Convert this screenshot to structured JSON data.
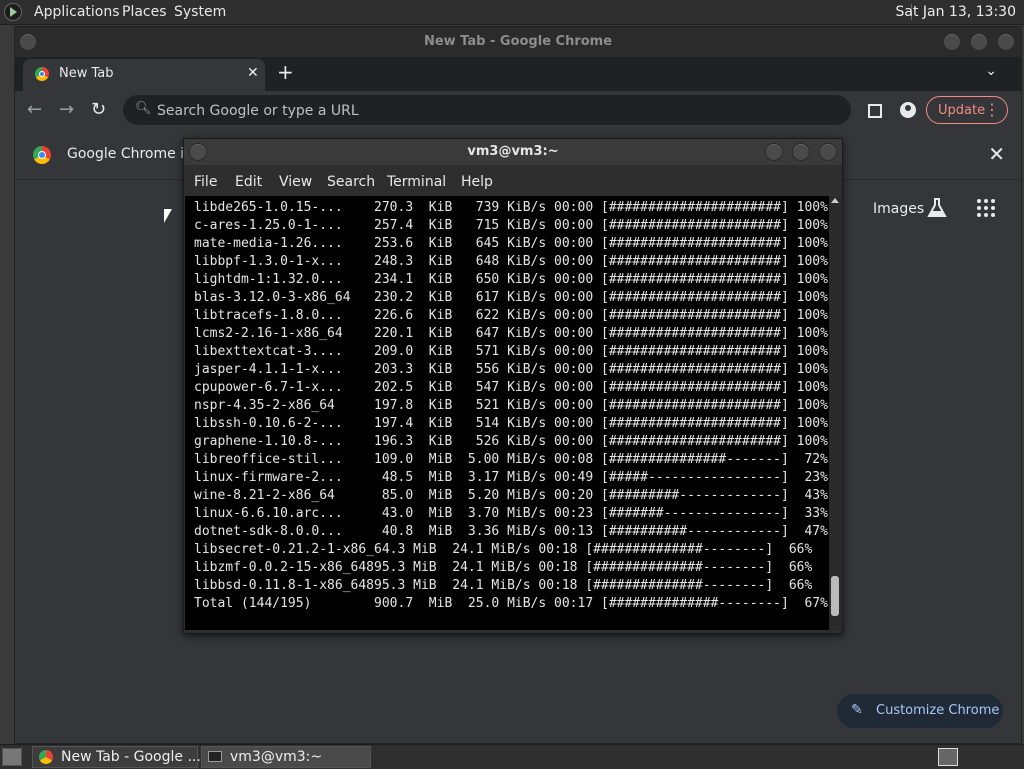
{
  "top_panel": {
    "menus": [
      "Applications",
      "Places",
      "System"
    ],
    "clock": "Sat Jan 13, 13:30"
  },
  "chrome": {
    "window_title": "New Tab - Google Chrome",
    "tab_label": "New Tab",
    "omnibox_placeholder": "Search Google or type a URL",
    "update_label": "Update",
    "infobar_text": "Google Chrome isn",
    "images_link": "Images",
    "customize_label": "Customize Chrome"
  },
  "terminal": {
    "title": "vm3@vm3:~",
    "menus": [
      "File",
      "Edit",
      "View",
      "Search",
      "Terminal",
      "Help"
    ],
    "lines": [
      "libde265-1.0.15-...    270.3  KiB   739 KiB/s 00:00 [######################] 100%",
      "c-ares-1.25.0-1-...    257.4  KiB   715 KiB/s 00:00 [######################] 100%",
      "mate-media-1.26....    253.6  KiB   645 KiB/s 00:00 [######################] 100%",
      "libbpf-1.3.0-1-x...    248.3  KiB   648 KiB/s 00:00 [######################] 100%",
      "lightdm-1:1.32.0...    234.1  KiB   650 KiB/s 00:00 [######################] 100%",
      "blas-3.12.0-3-x86_64   230.2  KiB   617 KiB/s 00:00 [######################] 100%",
      "libtracefs-1.8.0...    226.6  KiB   622 KiB/s 00:00 [######################] 100%",
      "lcms2-2.16-1-x86_64    220.1  KiB   647 KiB/s 00:00 [######################] 100%",
      "libexttextcat-3....    209.0  KiB   571 KiB/s 00:00 [######################] 100%",
      "jasper-4.1.1-1-x...    203.3  KiB   556 KiB/s 00:00 [######################] 100%",
      "cpupower-6.7-1-x...    202.5  KiB   547 KiB/s 00:00 [######################] 100%",
      "nspr-4.35-2-x86_64     197.8  KiB   521 KiB/s 00:00 [######################] 100%",
      "libssh-0.10.6-2-...    197.4  KiB   514 KiB/s 00:00 [######################] 100%",
      "graphene-1.10.8-...    196.3  KiB   526 KiB/s 00:00 [######################] 100%",
      "libreoffice-stil...    109.0  MiB  5.00 MiB/s 00:08 [###############-------]  72%",
      "linux-firmware-2...     48.5  MiB  3.17 MiB/s 00:49 [#####-----------------]  23%",
      "wine-8.21-2-x86_64      85.0  MiB  5.20 MiB/s 00:20 [#########-------------]  43%",
      "linux-6.6.10.arc...     43.0  MiB  3.70 MiB/s 00:23 [#######---------------]  33%",
      "dotnet-sdk-8.0.0...     40.8  MiB  3.36 MiB/s 00:13 [##########------------]  47%",
      "libsecret-0.21.2-1-x86_64.3 MiB  24.1 MiB/s 00:18 [##############--------]  66%",
      "libzmf-0.0.2-15-x86_64895.3 MiB  24.1 MiB/s 00:18 [##############--------]  66%",
      "libbsd-0.11.8-1-x86_64895.3 MiB  24.1 MiB/s 00:18 [##############--------]  66%",
      "Total (144/195)        900.7  MiB  25.0 MiB/s 00:17 [##############--------]  67%"
    ]
  },
  "taskbar": {
    "tasks": [
      "New Tab - Google ...",
      "vm3@vm3:~"
    ]
  }
}
